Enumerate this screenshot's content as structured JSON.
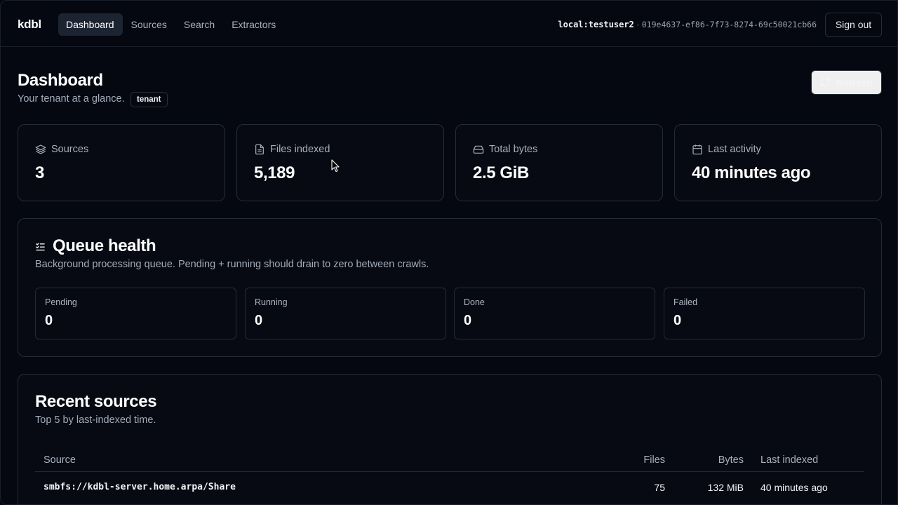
{
  "app": {
    "brand": "kdbl"
  },
  "nav": {
    "items": [
      {
        "label": "Dashboard",
        "active": true
      },
      {
        "label": "Sources",
        "active": false
      },
      {
        "label": "Search",
        "active": false
      },
      {
        "label": "Extractors",
        "active": false
      }
    ]
  },
  "user": {
    "name": "local:testuser2",
    "separator": "·",
    "id": "019e4637-ef86-7f73-8274-69c50021cb66",
    "signout_label": "Sign out"
  },
  "header": {
    "title": "Dashboard",
    "subtitle": "Your tenant at a glance.",
    "badge": "tenant",
    "refresh_label": "Refresh"
  },
  "stats": [
    {
      "icon": "layers-icon",
      "label": "Sources",
      "value": "3"
    },
    {
      "icon": "file-icon",
      "label": "Files indexed",
      "value": "5,189"
    },
    {
      "icon": "hard-drive-icon",
      "label": "Total bytes",
      "value": "2.5 GiB"
    },
    {
      "icon": "calendar-icon",
      "label": "Last activity",
      "value": "40 minutes ago"
    }
  ],
  "queue": {
    "icon": "list-checks-icon",
    "title": "Queue health",
    "subtitle": "Background processing queue. Pending + running should drain to zero between crawls.",
    "cards": [
      {
        "label": "Pending",
        "value": "0"
      },
      {
        "label": "Running",
        "value": "0"
      },
      {
        "label": "Done",
        "value": "0"
      },
      {
        "label": "Failed",
        "value": "0"
      }
    ]
  },
  "recent": {
    "title": "Recent sources",
    "subtitle": "Top 5 by last-indexed time.",
    "columns": {
      "source": "Source",
      "files": "Files",
      "bytes": "Bytes",
      "last": "Last indexed"
    },
    "rows": [
      {
        "source": "smbfs://kdbl-server.home.arpa/Share",
        "files": "75",
        "bytes": "132 MiB",
        "last": "40 minutes ago"
      }
    ]
  },
  "colors": {
    "background": "#050811",
    "border": "#262c37",
    "muted_text": "#a3abb8",
    "active_nav": "#1d2431"
  }
}
